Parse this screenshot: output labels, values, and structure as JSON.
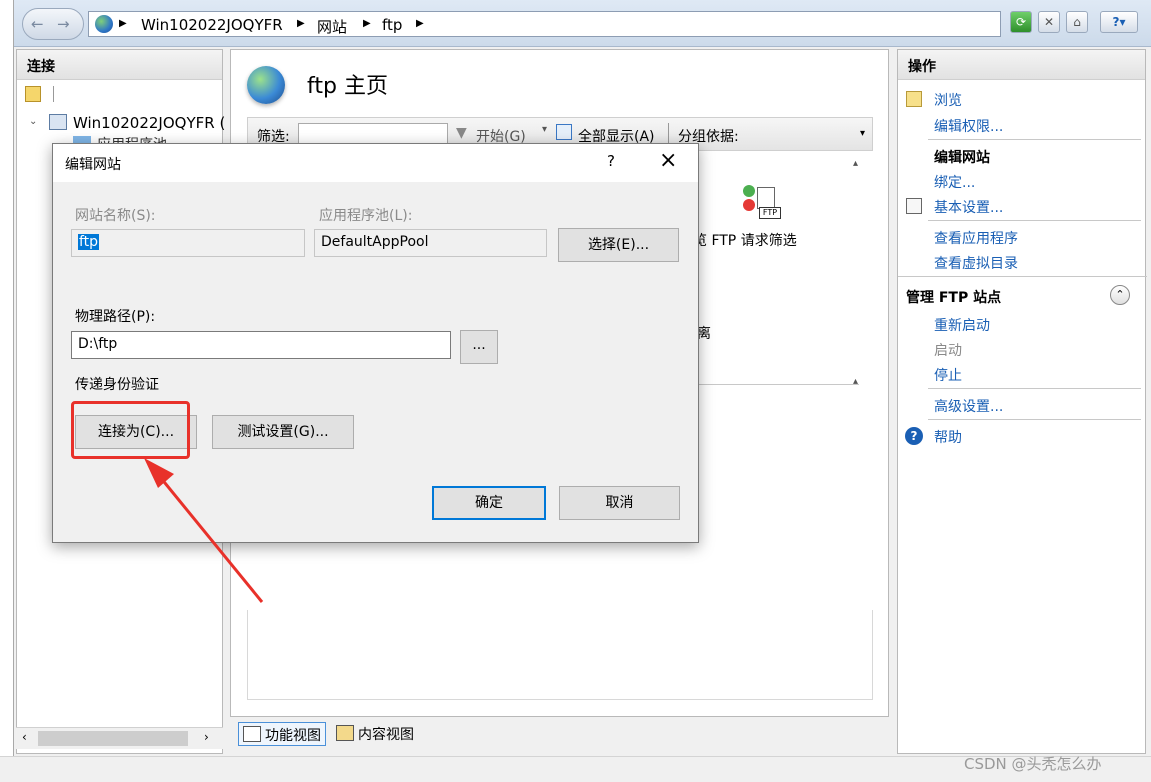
{
  "breadcrumb": [
    "Win102022JOQYFR",
    "网站",
    "ftp"
  ],
  "connections": {
    "title": "连接",
    "tree": [
      {
        "label": "Win102022JOQYFR ("
      },
      {
        "label": "应用程序池"
      }
    ]
  },
  "main": {
    "title": "ftp 主页",
    "filter_label": "筛选:",
    "start_label": "开始(G)",
    "show_all_label": "全部显示(A)",
    "group_by_label": "分组依据:",
    "feature_label": "览 FTP 请求筛选",
    "partial_label": "离",
    "tabs": [
      {
        "label": "功能视图"
      },
      {
        "label": "内容视图"
      }
    ]
  },
  "actions": {
    "title": "操作",
    "browse": "浏览",
    "edit_permissions": "编辑权限...",
    "edit_site_heading": "编辑网站",
    "bindings": "绑定...",
    "basic_settings": "基本设置...",
    "view_apps": "查看应用程序",
    "view_vdirs": "查看虚拟目录",
    "manage_heading": "管理 FTP 站点",
    "restart": "重新启动",
    "start": "启动",
    "stop": "停止",
    "advanced": "高级设置...",
    "help": "帮助"
  },
  "dialog": {
    "title": "编辑网站",
    "help_glyph": "?",
    "close_glyph": "×",
    "site_name_label": "网站名称(S):",
    "site_name_value": "ftp",
    "app_pool_label": "应用程序池(L):",
    "app_pool_value": "DefaultAppPool",
    "select_button": "选择(E)...",
    "physical_path_label": "物理路径(P):",
    "physical_path_value": "D:\\ftp",
    "browse_button": "...",
    "pass_auth_label": "传递身份验证",
    "connect_as_button": "连接为(C)...",
    "test_settings_button": "测试设置(G)...",
    "ok_button": "确定",
    "cancel_button": "取消"
  },
  "annotation_color": "#e8312a",
  "watermark": "CSDN @头秃怎么办"
}
